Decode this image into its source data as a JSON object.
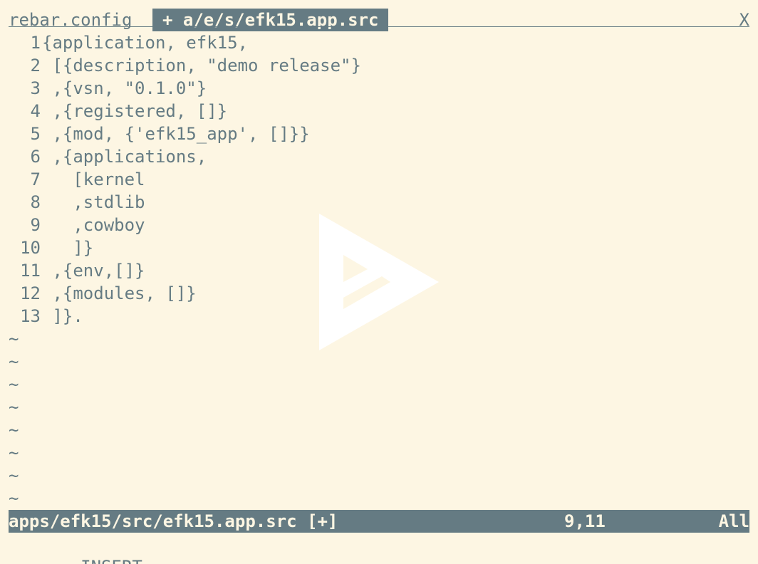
{
  "tabline": {
    "inactive_tab": "rebar.config",
    "active_tab": "+ a/e/s/efk15.app.src",
    "close_label": "X"
  },
  "editor": {
    "lines": [
      {
        "num": "1",
        "text": "{application, efk15,"
      },
      {
        "num": "2",
        "text": " [{description, \"demo release\"}"
      },
      {
        "num": "3",
        "text": " ,{vsn, \"0.1.0\"}"
      },
      {
        "num": "4",
        "text": " ,{registered, []}"
      },
      {
        "num": "5",
        "text": " ,{mod, {'efk15_app', []}}"
      },
      {
        "num": "6",
        "text": " ,{applications,"
      },
      {
        "num": "7",
        "text": "   [kernel"
      },
      {
        "num": "8",
        "text": "   ,stdlib"
      },
      {
        "num": "9",
        "text": "   ,cowboy"
      },
      {
        "num": "10",
        "text": "   ]}"
      },
      {
        "num": "11",
        "text": " ,{env,[]}"
      },
      {
        "num": "12",
        "text": " ,{modules, []}"
      },
      {
        "num": "13",
        "text": " ]}."
      }
    ],
    "empty_marker": "~"
  },
  "statusline": {
    "file": "apps/efk15/src/efk15.app.src [+]",
    "position": "9,11",
    "percent": "All"
  },
  "cmdline": {
    "mode": "-- INSERT --"
  },
  "colors": {
    "background": "#fdf6e3",
    "foreground": "#657b83",
    "statusline_bg": "#657b83"
  },
  "icons": {
    "watermark": "play-logo-icon"
  }
}
